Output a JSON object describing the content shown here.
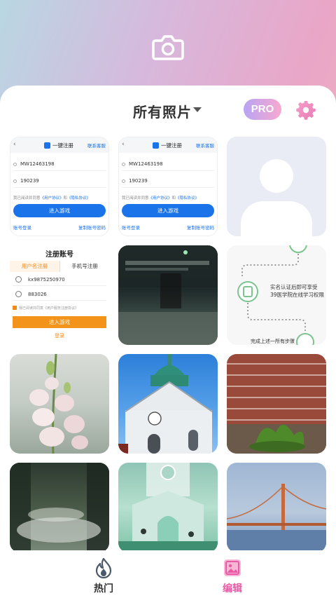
{
  "header": {
    "camera_icon": "camera-icon",
    "album_title": "所有照片",
    "pro_label": "PRO",
    "settings_icon": "gear-icon"
  },
  "photos": {
    "login1": {
      "back": "‹",
      "title": "一键注册",
      "service": "联系客服",
      "account": "MW12463198",
      "password": "190239",
      "agree_prefix": "我已阅读并同意",
      "agree_link1": "《用户协议》",
      "agree_and": "和",
      "agree_link2": "《隐私协议》",
      "enter": "进入游戏",
      "link_left": "账号登录",
      "link_right": "复制账号密码"
    },
    "login2": {
      "back": "‹",
      "title": "一键注册",
      "service": "联系客服",
      "account": "MW12463198",
      "password": "190239",
      "agree_prefix": "我已阅读并同意",
      "agree_link1": "《用户协议》",
      "agree_and": "和",
      "agree_link2": "《隐私协议》",
      "enter": "进入游戏",
      "link_left": "账号登录",
      "link_right": "复制账号密码"
    },
    "register": {
      "title": "注册账号",
      "tab_user": "用户名注册",
      "tab_phone": "手机号注册",
      "username": "kx9875250970",
      "password": "883026",
      "agree": "我已阅读并同意《用户服务注册协议》",
      "enter": "进入游戏",
      "login": "登录"
    },
    "flow": {
      "line1": "实名认证后即可享受",
      "line2": "39医学院在线学习权限",
      "tail": "完成上述一所有步骤"
    }
  },
  "nav": {
    "hot_label": "热门",
    "edit_label": "编辑",
    "hot_icon": "flame-icon",
    "edit_icon": "image-edit-icon"
  },
  "colors": {
    "accent_pink": "#e85aa6",
    "login_blue": "#1a73e8",
    "register_orange": "#f39319"
  }
}
